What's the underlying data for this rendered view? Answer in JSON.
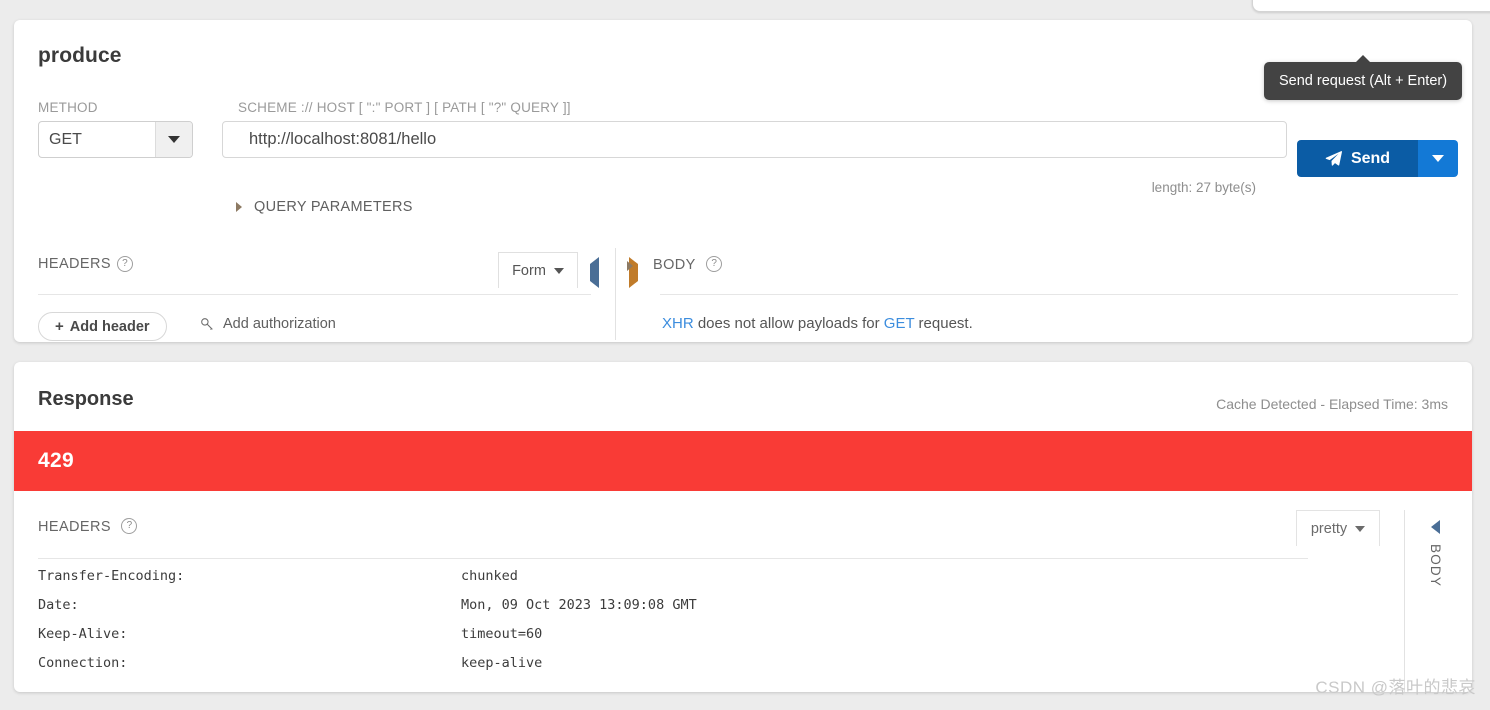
{
  "request": {
    "title": "produce",
    "method_label": "METHOD",
    "method_value": "GET",
    "url_label": "SCHEME :// HOST [ \":\" PORT ] [ PATH [ \"?\" QUERY ]]",
    "url_value": "http://localhost:8081/hello",
    "url_placeholder": "http://localhost:8081/hello",
    "length_note": "length: 27 byte(s)",
    "send_label": "Send",
    "send_tooltip": "Send request (Alt + Enter)",
    "query_parameters_label": "QUERY PARAMETERS",
    "headers_label": "HEADERS",
    "form_dropdown_value": "Form",
    "add_header_label": "Add header",
    "add_authorization_label": "Add authorization",
    "body_label": "BODY",
    "body_message": {
      "link1": "XHR",
      "mid": " does not allow payloads for ",
      "link2": "GET",
      "tail": " request."
    }
  },
  "response": {
    "title": "Response",
    "meta": "Cache Detected - Elapsed Time: 3ms",
    "status_code": "429",
    "status_color": "#f93b36",
    "headers_label": "HEADERS",
    "format_dropdown_value": "pretty",
    "body_tab_label": "BODY",
    "headers": [
      {
        "name": "Transfer-Encoding:",
        "value": "chunked"
      },
      {
        "name": "Date:",
        "value": "Mon, 09 Oct 2023 13:09:08 GMT"
      },
      {
        "name": "Keep-Alive:",
        "value": "timeout=60"
      },
      {
        "name": "Connection:",
        "value": "keep-alive"
      }
    ]
  },
  "watermark": "CSDN @落叶的悲哀"
}
